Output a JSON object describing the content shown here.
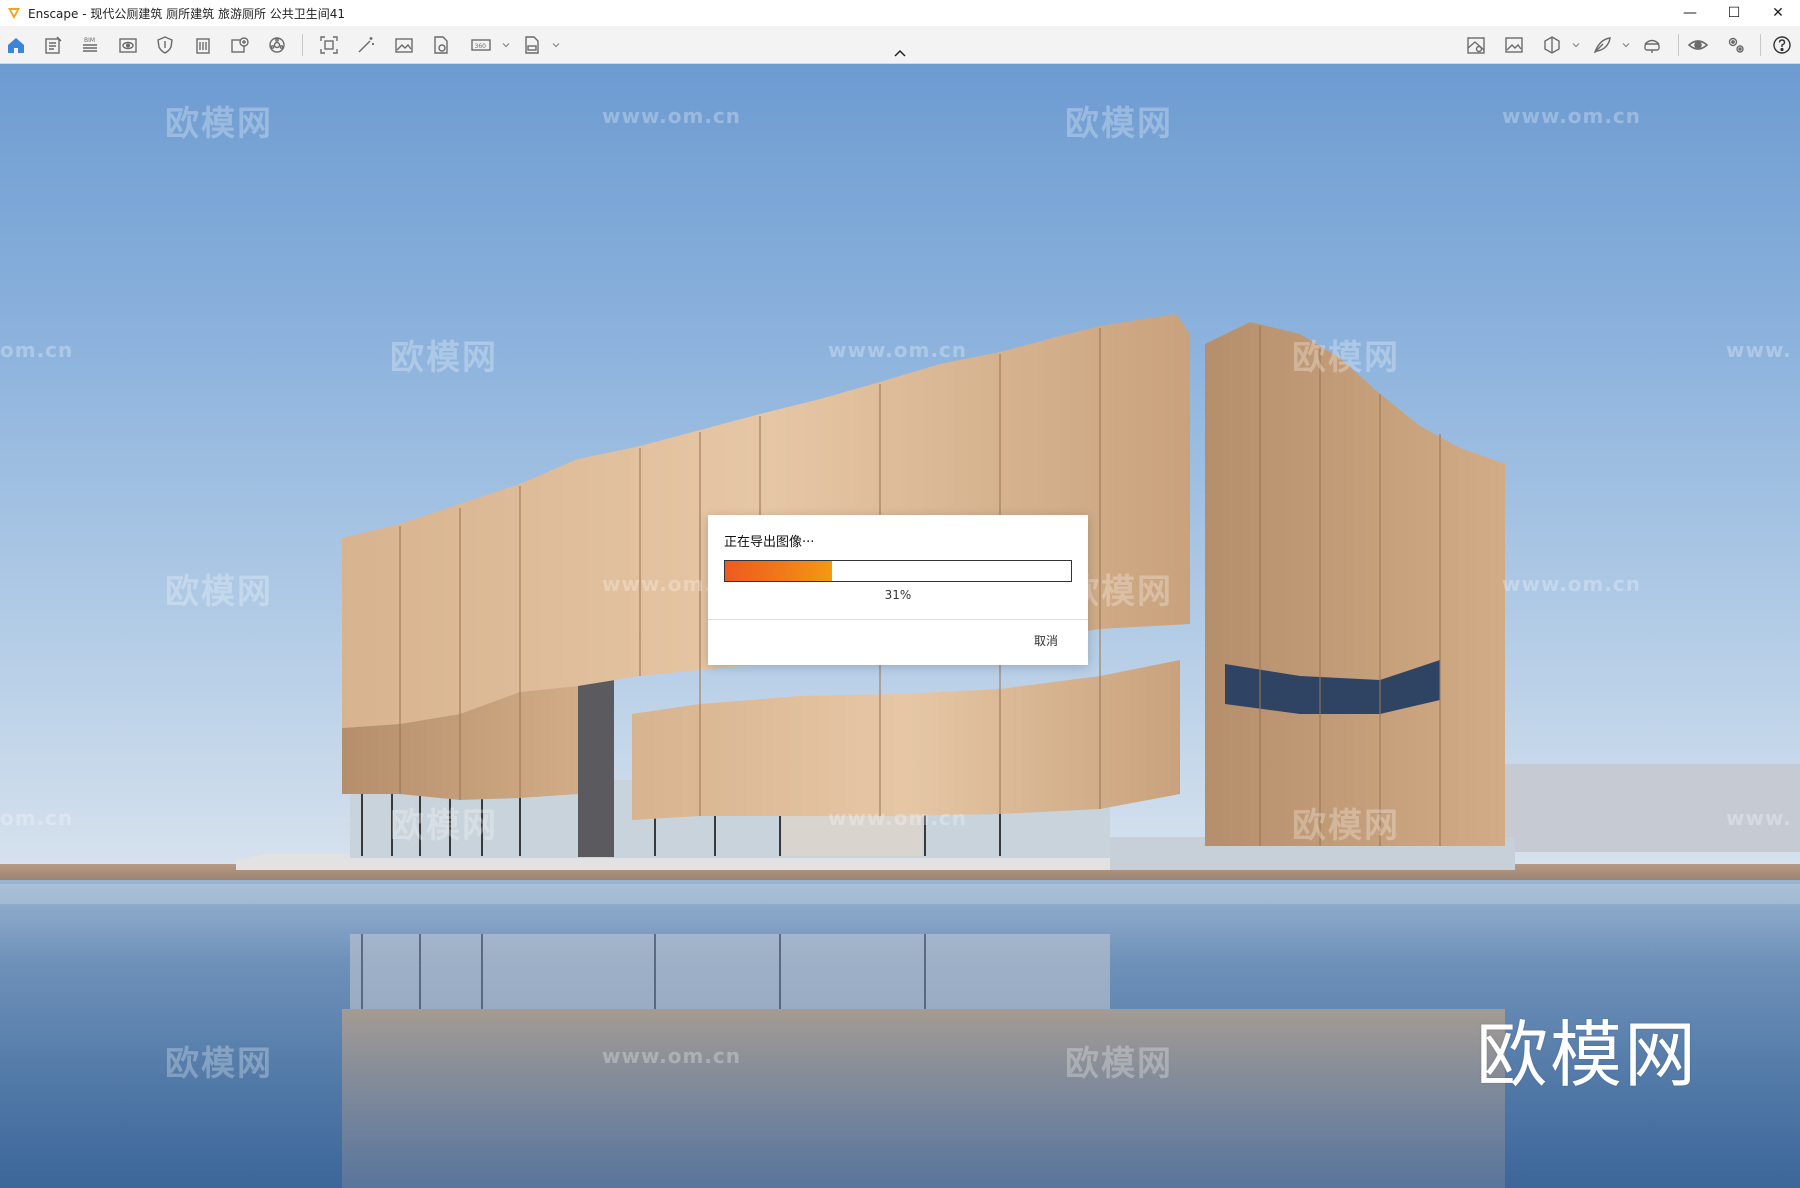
{
  "window": {
    "title": "Enscape - 现代公厕建筑 厕所建筑 旅游厕所 公共卫生间41",
    "controls": {
      "minimize": "—",
      "maximize": "☐",
      "close": "✕"
    }
  },
  "toolbar": {
    "left_icons": [
      "home-icon",
      "notes-icon",
      "bim-icon",
      "view-icon",
      "shield-icon",
      "building-icon",
      "add-view-icon",
      "sun-icon",
      "screenshot-icon",
      "magic-wand-icon",
      "image-icon",
      "export-file-icon",
      "panorama-360-icon",
      "batch-export-icon"
    ],
    "right_icons": [
      "map-icon",
      "image-gallery-icon",
      "cube-icon",
      "feather-icon",
      "vr-icon",
      "eye-icon",
      "settings-icon",
      "help-icon"
    ],
    "bim_label": "BIM",
    "pano_label": "360"
  },
  "watermarks": {
    "cn": "欧模网",
    "url": "www.om.cn",
    "url_partial_left": "om.cn",
    "url_partial_right": "www.",
    "big_logo": "欧模网"
  },
  "dialog": {
    "title": "正在导出图像···",
    "progress": 0.31,
    "percent_text": "31%",
    "cancel_label": "取消"
  },
  "colors": {
    "accent": "#3b84d6",
    "progress_start": "#ef5a1f",
    "progress_end": "#f39912"
  }
}
